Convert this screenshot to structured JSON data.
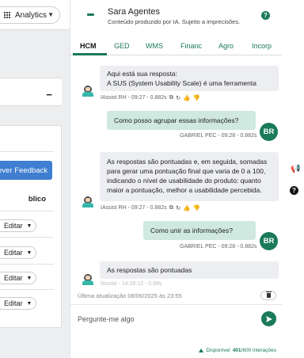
{
  "background_app": {
    "selector_label": "Analytics",
    "feedback_button": "rever Feedback",
    "column_header": "blico",
    "edit_label": "Editar"
  },
  "chat": {
    "title": "Sara Agentes",
    "subtitle": "Conteúdo produzido por IA. Sujeito a imprecisões.",
    "tabs": [
      {
        "label": "HCM",
        "active": true
      },
      {
        "label": "GED",
        "active": false
      },
      {
        "label": "WMS",
        "active": false
      },
      {
        "label": "Financ",
        "active": false
      },
      {
        "label": "Agro",
        "active": false
      },
      {
        "label": "Incorp",
        "active": false
      }
    ],
    "messages": [
      {
        "role": "bot",
        "lines": [
          "Aqui está sua resposta:",
          "A SUS (System Usability Scale) é uma ferramenta"
        ],
        "meta": "IAssist RH - 09:27 - 0.882s"
      },
      {
        "role": "user",
        "lines": [
          "Como posso agrupar essas informações?"
        ],
        "meta": "GABRIEL PEC - 09:28 - 0.882s",
        "initials": "BR"
      },
      {
        "role": "bot",
        "lines": [
          "As respostas são pontuadas e, em seguida, somadas",
          "para gerar uma pontuação final que varia de 0 a 100,",
          "indicando o nível de usabilidade do produto: quanto",
          "maior a pontuação, melhor a usabilidade percebida."
        ],
        "meta": "IAssist RH - 09:27 - 0.882s"
      },
      {
        "role": "user",
        "lines": [
          "Como unir as informações?"
        ],
        "meta": "GABRIEL PEC - 09:28 - 0.882s",
        "initials": "BR"
      },
      {
        "role": "bot",
        "lines": [
          "As respostas são pontuadas"
        ],
        "meta": "IAssist - 14:26:12 - 0.88s"
      }
    ],
    "last_updated": "Última atualização 08/06/2025 às 23:55",
    "input_placeholder": "Pergunte-me algo",
    "status_prefix": "Disponível",
    "status_used": "401",
    "status_suffix": "/600 interações"
  },
  "colors": {
    "accent": "#1a7a5a",
    "user_bubble": "#cfe8e0",
    "bot_bubble": "#edeef1",
    "feedback_blue": "#3f7ed1",
    "thumb_down": "#d03030"
  },
  "icons": [
    "grid-icon",
    "chevron-down-icon",
    "minimize-icon",
    "help-icon",
    "copy-icon",
    "refresh-icon",
    "thumbs-up-icon",
    "thumbs-down-icon",
    "trash-icon",
    "send-icon",
    "megaphone-icon",
    "bot-avatar-icon"
  ]
}
